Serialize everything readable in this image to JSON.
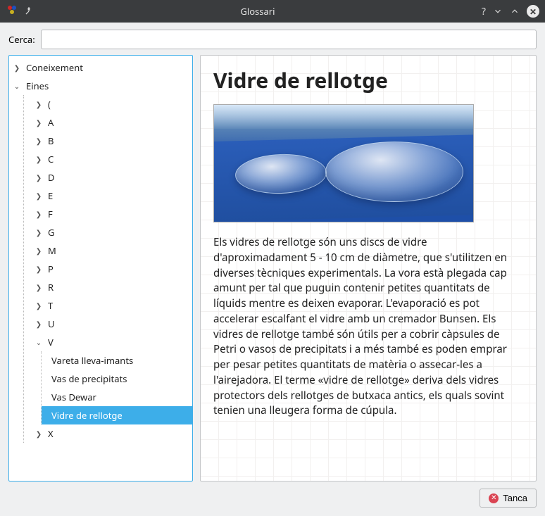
{
  "window": {
    "title": "Glossari"
  },
  "search": {
    "label": "Cerca:",
    "value": "",
    "placeholder": ""
  },
  "tree": {
    "root": [
      {
        "label": "Coneixement",
        "expanded": false
      },
      {
        "label": "Eines",
        "expanded": true
      }
    ],
    "eines_children": [
      {
        "label": "(",
        "expanded": false
      },
      {
        "label": "A",
        "expanded": false
      },
      {
        "label": "B",
        "expanded": false
      },
      {
        "label": "C",
        "expanded": false
      },
      {
        "label": "D",
        "expanded": false
      },
      {
        "label": "E",
        "expanded": false
      },
      {
        "label": "F",
        "expanded": false
      },
      {
        "label": "G",
        "expanded": false
      },
      {
        "label": "M",
        "expanded": false
      },
      {
        "label": "P",
        "expanded": false
      },
      {
        "label": "R",
        "expanded": false
      },
      {
        "label": "T",
        "expanded": false
      },
      {
        "label": "U",
        "expanded": false
      },
      {
        "label": "V",
        "expanded": true
      },
      {
        "label": "X",
        "expanded": false
      }
    ],
    "v_children": [
      {
        "label": "Vareta lleva-imants",
        "selected": false
      },
      {
        "label": "Vas de precipitats",
        "selected": false
      },
      {
        "label": "Vas Dewar",
        "selected": false
      },
      {
        "label": "Vidre de rellotge",
        "selected": true
      }
    ]
  },
  "content": {
    "title": "Vidre de rellotge",
    "image_alt": "watch-glass-photo",
    "body": "Els vidres de rellotge són uns discs de vidre d'aproximadament 5 - 10 cm de diàmetre, que s'utilitzen en diverses tècniques experimentals. La vora està plegada cap amunt per tal que puguin contenir petites quantitats de líquids mentre es deixen evaporar. L'evaporació es pot accelerar escalfant el vidre amb un cremador Bunsen. Els vidres de rellotge també són útils per a cobrir càpsules de Petri o vasos de precipitats i a més també es poden emprar per pesar petites quantitats de matèria o assecar-les a l'airejadora. El terme «vidre de rellotge» deriva dels vidres protectors dels rellotges de butxaca antics, els quals sovint tenien una lleugera forma de cúpula."
  },
  "buttons": {
    "close": "Tanca"
  }
}
